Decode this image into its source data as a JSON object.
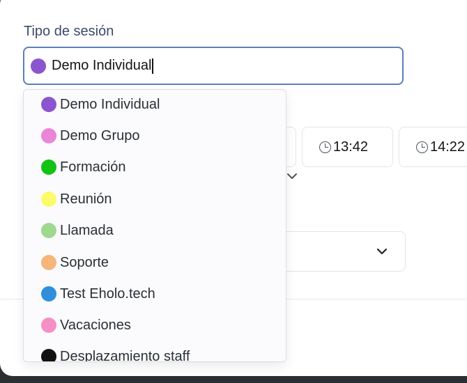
{
  "field": {
    "label": "Tipo de sesión",
    "value": "Demo Individual",
    "value_color": "#8a55cf"
  },
  "background": {
    "time_slots": [
      "13:42",
      "14:22"
    ]
  },
  "dropdown": {
    "options": [
      {
        "label": "Demo Individual",
        "color": "#8a55cf"
      },
      {
        "label": "Demo Grupo",
        "color": "#ea85d9"
      },
      {
        "label": "Formación",
        "color": "#14c214"
      },
      {
        "label": "Reunión",
        "color": "#fbfb6b"
      },
      {
        "label": "Llamada",
        "color": "#9fd88f"
      },
      {
        "label": "Soporte",
        "color": "#f6b57a"
      },
      {
        "label": "Test Eholo.tech",
        "color": "#2f8fdc"
      },
      {
        "label": "Vacaciones",
        "color": "#f68fc6"
      },
      {
        "label": "Desplazamiento staff",
        "color": "#111111"
      }
    ]
  },
  "icons": {
    "clock": "clock-icon",
    "chevron": "chevron-down-icon"
  }
}
